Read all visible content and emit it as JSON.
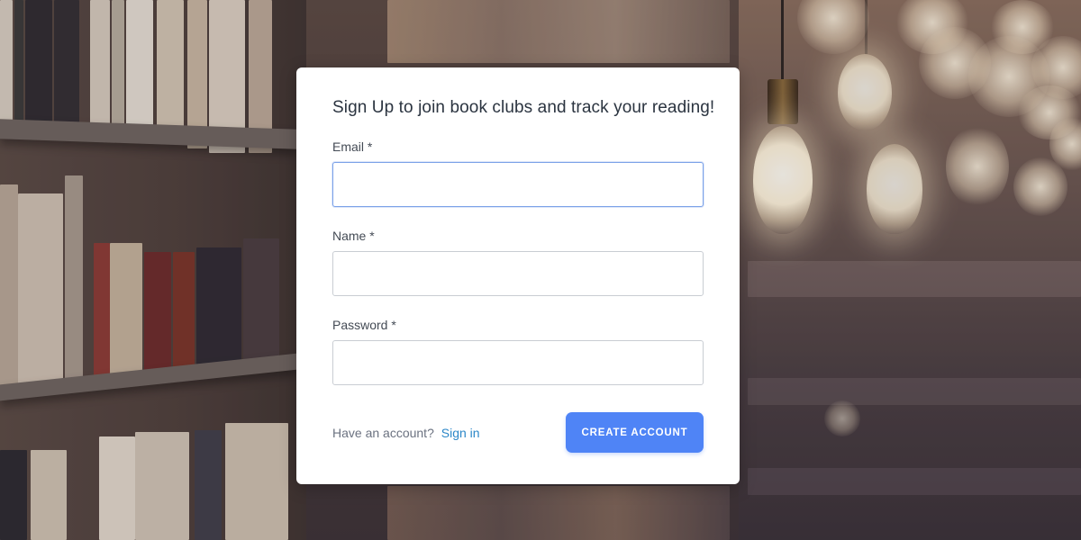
{
  "signup": {
    "title": "Sign Up to join book clubs and track your reading!",
    "fields": {
      "email": {
        "label": "Email *",
        "value": "",
        "placeholder": ""
      },
      "name": {
        "label": "Name *",
        "value": "",
        "placeholder": ""
      },
      "password": {
        "label": "Password *",
        "value": "",
        "placeholder": ""
      }
    },
    "have_account_text": "Have an account?",
    "sign_in_link": "Sign in",
    "create_account_button": "CREATE ACCOUNT"
  },
  "colors": {
    "accent": "#4f84f6",
    "link": "#2b87c8",
    "focus_border": "#7aa1e8",
    "title_text": "#2b3440"
  },
  "background": {
    "description_icon": "library-bookshelf-photo"
  }
}
